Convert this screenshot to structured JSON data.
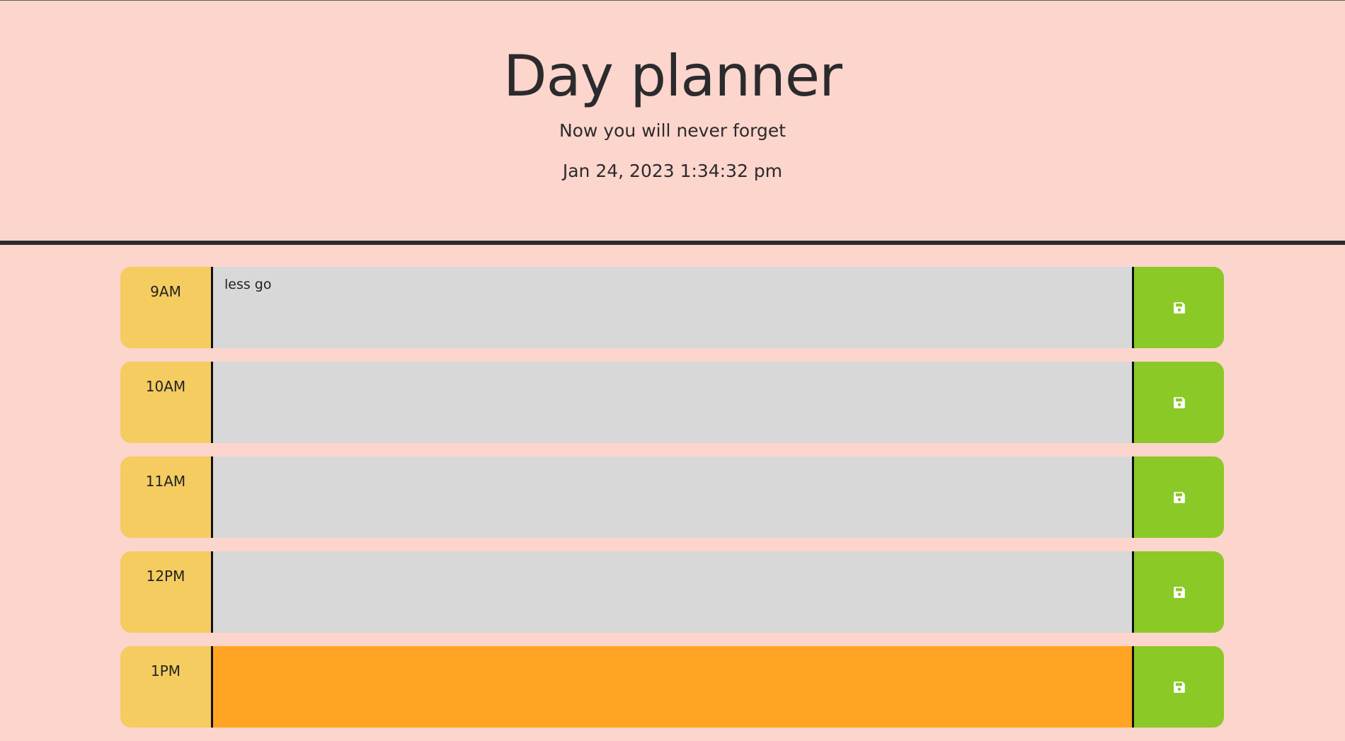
{
  "header": {
    "title": "Day planner",
    "subtitle": "Now you will never forget",
    "current_day": "Jan 24, 2023 1:34:32 pm"
  },
  "time_blocks": [
    {
      "hour": "9AM",
      "description": "less go",
      "state": "past"
    },
    {
      "hour": "10AM",
      "description": "",
      "state": "past"
    },
    {
      "hour": "11AM",
      "description": "",
      "state": "past"
    },
    {
      "hour": "12PM",
      "description": "",
      "state": "past"
    },
    {
      "hour": "1PM",
      "description": "",
      "state": "present"
    }
  ],
  "save_icon": "floppy-disk-icon",
  "colors": {
    "page_background": "#fcd5cc",
    "hour_background": "#f4cc60",
    "past": "#d8d8d8",
    "present": "#ffa523",
    "save_button": "#8bc927",
    "divider": "#2b2b2e"
  }
}
